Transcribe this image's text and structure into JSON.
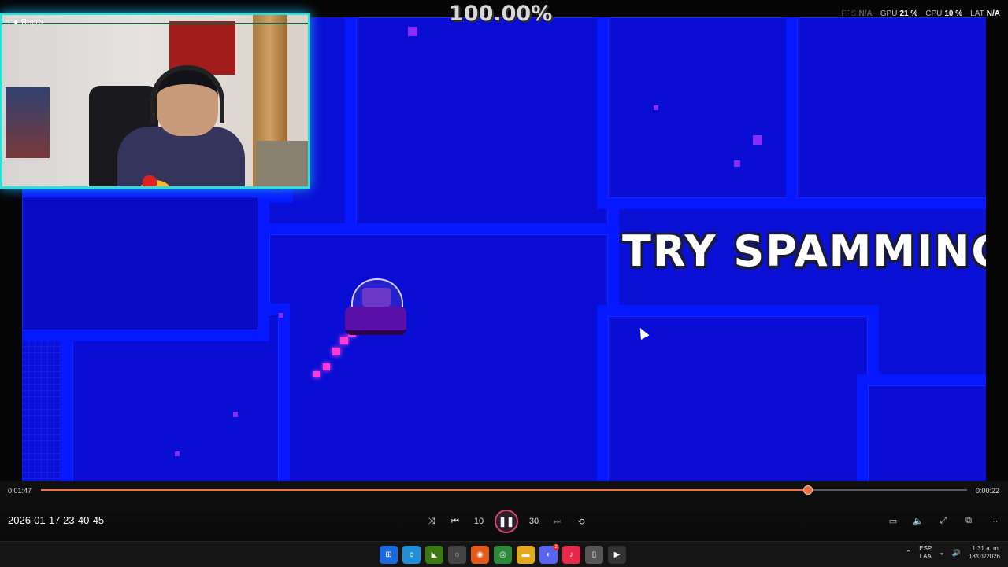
{
  "game": {
    "progress_percent": "100.00%",
    "hint_text": "TRY SPAMMING",
    "stats": [
      {
        "label": "FPS",
        "value": "N/A"
      },
      {
        "label": "GPU",
        "value": "21 %"
      },
      {
        "label": "CPU",
        "value": "10 %"
      },
      {
        "label": "LAT",
        "value": "N/A"
      }
    ],
    "colors": {
      "background": "#0a10d6",
      "block_border": "#0618ff",
      "trail": "#ff3ad8"
    }
  },
  "webcam": {
    "overlay_label": "Repro",
    "border_color": "#2de0d8",
    "icons": [
      "home-icon",
      "record-icon"
    ]
  },
  "player": {
    "elapsed": "0:01:47",
    "remaining": "0:00:22",
    "progress_fraction": 0.828,
    "file_title": "2026-01-17 23-40-45",
    "controls": {
      "shuffle_icon": "⤨",
      "prev_icon": "⏮",
      "rewind_icon": "↶",
      "rewind_label": "10",
      "pause_icon": "❚❚",
      "forward_icon": "↷",
      "forward_label": "30",
      "next_icon": "⏭",
      "repeat_icon": "⟲"
    },
    "right_controls": {
      "captions_icon": "▭",
      "volume_icon": "🔈",
      "fullscreen_icon": "⤢",
      "miniplayer_icon": "⧉",
      "more_icon": "⋯"
    },
    "accent_color": "#e8734a"
  },
  "taskbar": {
    "apps": [
      {
        "name": "start-icon",
        "glyph": "⊞",
        "bg": "#1a6adf"
      },
      {
        "name": "edge-icon",
        "glyph": "e",
        "bg": "#1f8fd8"
      },
      {
        "name": "nvidia-icon",
        "glyph": "◣",
        "bg": "#3a7a12"
      },
      {
        "name": "clock-app-icon",
        "glyph": "◌",
        "bg": "#444"
      },
      {
        "name": "orange-app-icon",
        "glyph": "◉",
        "bg": "#e35a1a"
      },
      {
        "name": "chrome-icon",
        "glyph": "◎",
        "bg": "#2a8a3a"
      },
      {
        "name": "file-explorer-icon",
        "glyph": "▬",
        "bg": "#e2a91a"
      },
      {
        "name": "discord-icon",
        "glyph": "◐",
        "bg": "#5865f2"
      },
      {
        "name": "tiktok-icon",
        "glyph": "♪",
        "bg": "#e8284a"
      },
      {
        "name": "usb-icon",
        "glyph": "▯",
        "bg": "#555"
      },
      {
        "name": "media-player-icon",
        "glyph": "▶",
        "bg": "#333"
      }
    ],
    "discord_badge": "2",
    "tray": {
      "overflow_icon": "⌃",
      "language": "ESP",
      "layout": "LAA",
      "wifi_icon": "◒",
      "volume_icon": "🔊",
      "time": "1:31 a. m.",
      "date": "18/01/2026"
    }
  }
}
